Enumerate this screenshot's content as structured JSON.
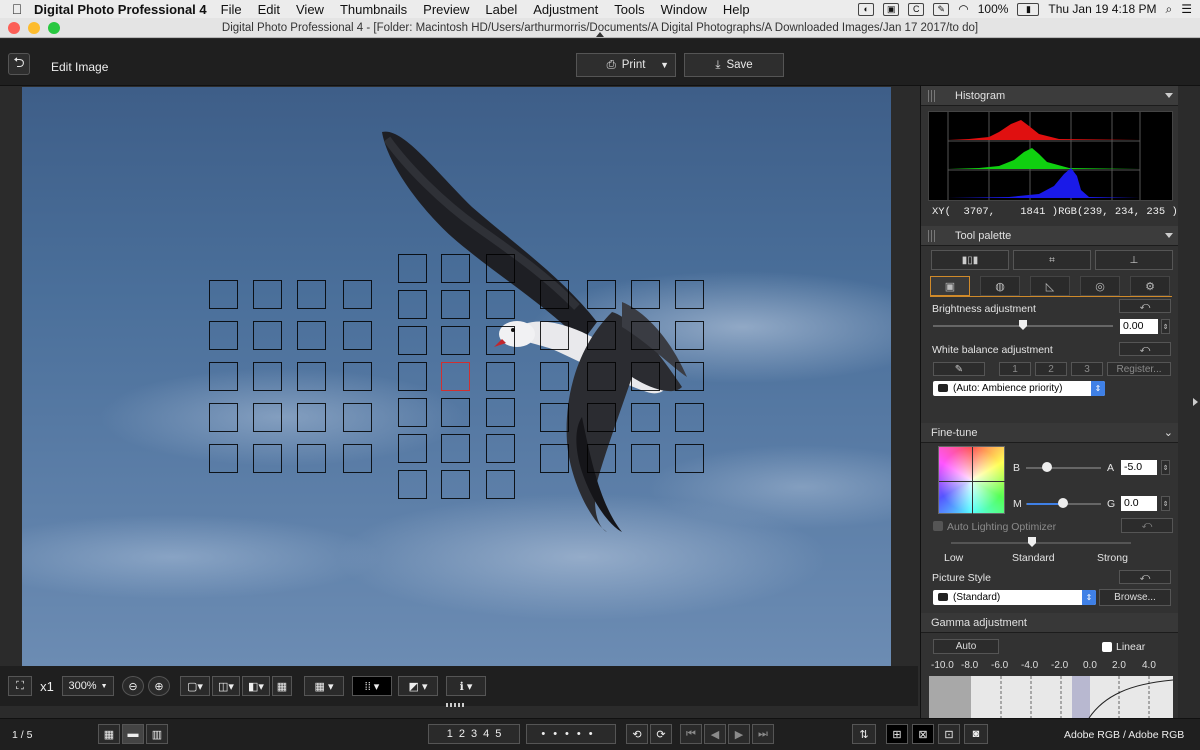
{
  "menubar": {
    "app": "Digital Photo Professional 4",
    "items": [
      "File",
      "Edit",
      "View",
      "Thumbnails",
      "Preview",
      "Label",
      "Adjustment",
      "Tools",
      "Window",
      "Help"
    ],
    "battery": "100%",
    "clock": "Thu Jan 19  4:18 PM"
  },
  "window": {
    "title": "Digital Photo Professional 4 - [Folder: Macintosh HD/Users/arthurmorris/Documents/A Digital Photographs/A Downloaded Images/Jan 17 2017/to do]"
  },
  "toolbar": {
    "mode_title": "Edit Image",
    "print_label": "Print",
    "save_label": "Save"
  },
  "viewbar": {
    "zoom_x1": "x1",
    "zoom_level": "300%"
  },
  "statusbar": {
    "page_counter": "1 / 5",
    "rating_marks": [
      "1",
      "2",
      "3",
      "4",
      "5"
    ],
    "color_space": "Adobe RGB / Adobe RGB"
  },
  "panel": {
    "histogram": {
      "title": "Histogram",
      "xy_label": "XY(",
      "x": "3707",
      "y": "1841",
      "rgb_label": "RGB(",
      "r": "239",
      "g": "234",
      "b": "235"
    },
    "tool_palette": {
      "title": "Tool palette"
    },
    "brightness": {
      "label": "Brightness adjustment",
      "value": "0.00"
    },
    "white_balance": {
      "label": "White balance adjustment",
      "slots": [
        "1",
        "2",
        "3"
      ],
      "register": "Register...",
      "mode": "(Auto: Ambience priority)"
    },
    "fine_tune": {
      "title": "Fine-tune",
      "b": "B",
      "a": "A",
      "a_value": "-5.0",
      "m": "M",
      "g": "G",
      "g_value": "0.0"
    },
    "alo": {
      "label": "Auto Lighting Optimizer",
      "low": "Low",
      "standard": "Standard",
      "strong": "Strong"
    },
    "picture_style": {
      "label": "Picture Style",
      "value": "(Standard)",
      "browse": "Browse..."
    },
    "gamma": {
      "title": "Gamma adjustment",
      "auto": "Auto",
      "linear": "Linear",
      "scale": [
        "-10.0",
        "-8.0",
        "-6.0",
        "-4.0",
        "-2.0",
        "0.0",
        "2.0",
        "4.0"
      ]
    }
  },
  "colors": {
    "accent_orange": "#d08a2a",
    "selected_af": "#d03030",
    "select_blue": "#3f80e6"
  },
  "icons": [
    "apple-icon",
    "back-icon",
    "printer-icon",
    "save-icon",
    "fit-icon",
    "zoom-out-icon",
    "zoom-in-icon",
    "grid-icon",
    "af-points-icon",
    "info-icon",
    "rotate-icon",
    "gear-icon"
  ]
}
